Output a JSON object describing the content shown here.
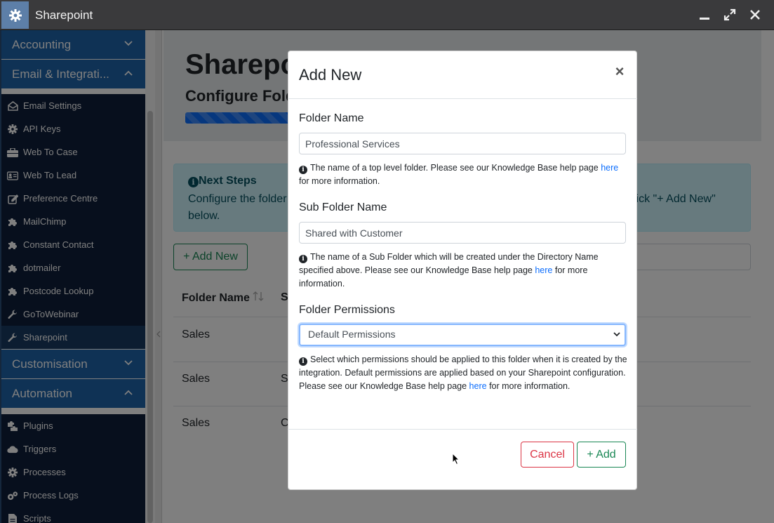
{
  "window": {
    "title": "Sharepoint",
    "controls": [
      "minimize-icon",
      "maximize-icon",
      "close-icon"
    ]
  },
  "sidebar": {
    "sections": {
      "accounting": "Accounting",
      "email_integrations": "Email & Integrati...",
      "customisation": "Customisation",
      "automation": "Automation"
    },
    "email_items": [
      {
        "label": "Email Settings",
        "icon": "envelope-open-icon"
      },
      {
        "label": "API Keys",
        "icon": "gear-icon"
      },
      {
        "label": "Web To Case",
        "icon": "briefcase-icon"
      },
      {
        "label": "Web To Lead",
        "icon": "id-card-icon"
      },
      {
        "label": "Preference Centre",
        "icon": "edit-icon"
      },
      {
        "label": "MailChimp",
        "icon": "puzzle-icon"
      },
      {
        "label": "Constant Contact",
        "icon": "puzzle-icon"
      },
      {
        "label": "dotmailer",
        "icon": "puzzle-icon"
      },
      {
        "label": "Postcode Lookup",
        "icon": "puzzle-icon"
      },
      {
        "label": "GoToWebinar",
        "icon": "wrench-icon"
      },
      {
        "label": "Sharepoint",
        "icon": "wrench-icon",
        "active": true
      }
    ],
    "automation_items": [
      {
        "label": "Plugins",
        "icon": "puzzle-pieces-icon"
      },
      {
        "label": "Triggers",
        "icon": "cloud-icon"
      },
      {
        "label": "Processes",
        "icon": "gear-icon"
      },
      {
        "label": "Process Logs",
        "icon": "gears-icon"
      },
      {
        "label": "Scripts",
        "icon": "file-icon"
      }
    ]
  },
  "page": {
    "title": "Sharepo",
    "subtitle": "Configure Fold",
    "next_steps_title": "Next Steps",
    "next_steps_left": "Configure the folder",
    "next_steps_right": "lick \"+ Add New\"",
    "next_steps_line2": "below.",
    "add_new_button": "+ Add New",
    "table": {
      "headers": [
        "Folder Name",
        "S"
      ],
      "rows": [
        [
          "Sales",
          ""
        ],
        [
          "Sales",
          "S"
        ],
        [
          "Sales",
          "C"
        ]
      ]
    }
  },
  "modal": {
    "title": "Add New",
    "folder_name": {
      "label": "Folder Name",
      "value": "Professional Services",
      "help_before": "The name of a top level folder. Please see our Knowledge Base help page",
      "help_link": "here",
      "help_after": "for more information."
    },
    "sub_folder_name": {
      "label": "Sub Folder Name",
      "value": "Shared with Customer",
      "help_before": "The name of a Sub Folder which will be created under the Directory Name specified above. Please see our Knowledge Base help page",
      "help_link": "here",
      "help_after": "for more information."
    },
    "folder_permissions": {
      "label": "Folder Permissions",
      "selected": "Default Permissions",
      "help_before": "Select which permissions should be applied to this folder when it is created by the integration. Default permissions are applied based on your Sharepoint configuration. Please see our Knowledge Base help page",
      "help_link": "here",
      "help_after": "for more information."
    },
    "cancel_button": "Cancel",
    "add_button": "+ Add"
  },
  "colors": {
    "sidebar_header": "#1e64aa",
    "sidebar_item_bg": "#0e1f3b",
    "sidebar_active": "#193a62",
    "titlebar": "#3a3a3c",
    "link": "#0d6efd",
    "danger": "#dc3545",
    "success": "#198754"
  }
}
